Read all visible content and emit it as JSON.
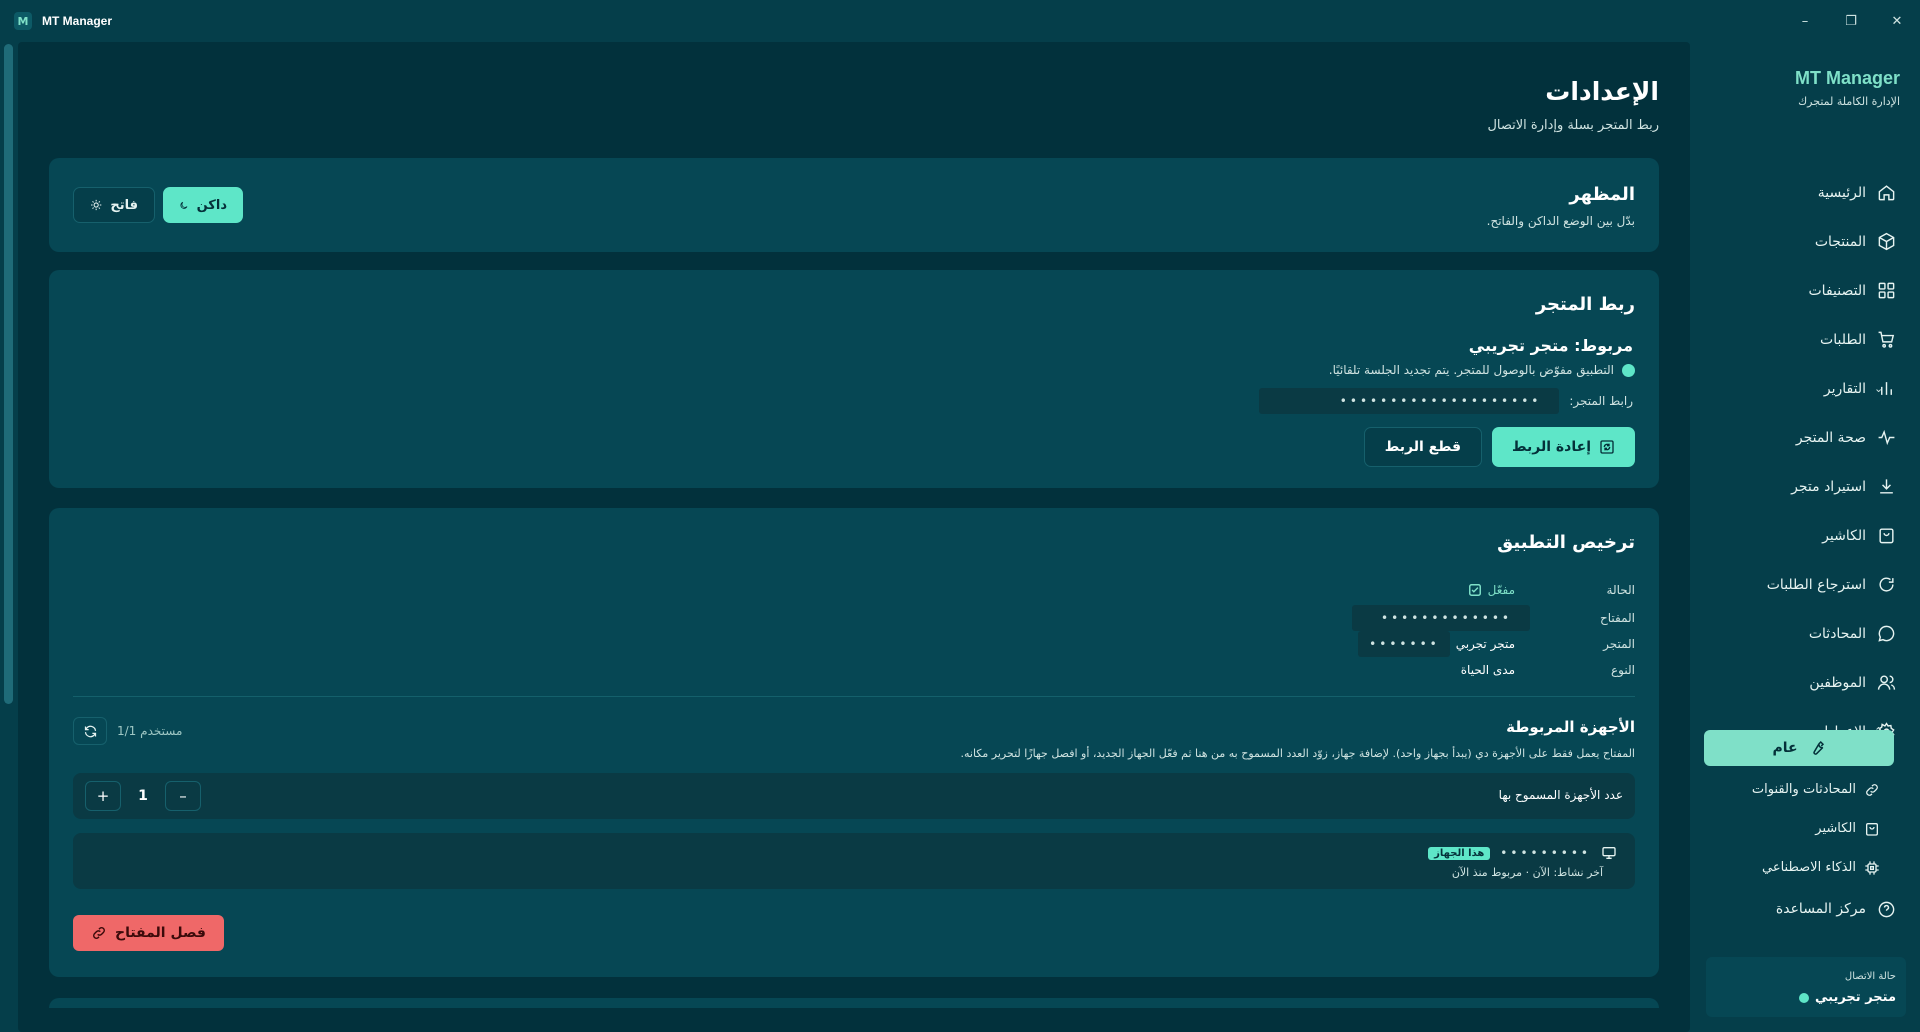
{
  "window": {
    "title": "MT Manager",
    "app_icon_letter": "M",
    "minimize": "–",
    "maximize": "❐",
    "close": "✕"
  },
  "page": {
    "title": "الإعدادات",
    "subtitle": "ربط المتجر بسلة وإدارة الاتصال"
  },
  "appearance": {
    "title": "المظهر",
    "description": "بدّل بين الوضع الداكن والفاتح.",
    "dark_label": "داكن",
    "light_label": "فاتح",
    "active": "dark"
  },
  "store_link": {
    "title": "ربط المتجر",
    "connected_text": "مربوط: متجر تجريبي",
    "status_text": "التطبيق مفوّض بالوصول للمتجر. يتم تجديد الجلسة تلقائيًا.",
    "link_label": "رابط المتجر:",
    "link_value": "••••••••••••••••••••",
    "reconnect_label": "إعادة الربط",
    "disconnect_label": "قطع الربط"
  },
  "license": {
    "title": "ترخيص التطبيق",
    "status_key": "الحالة",
    "status_value": "مفعّل",
    "key_key": "المفتاح",
    "key_value": "•••••••••••••",
    "store_key": "المتجر",
    "store_value": "متجر تجربي",
    "store_masked": "•••••••",
    "type_key": "النوع",
    "type_value": "مدى الحياة",
    "devices_title": "الأجهزة المربوطة",
    "devices_desc": "المفتاح يعمل فقط على الأجهزة دي (يبدأ بجهاز واحد). لإضافة جهاز، زوّد العدد المسموح به من هنا ثم فعّل الجهاز الجديد، أو افصل جهازًا لتحرير مكانه.",
    "user_count": "1/1 مستخدم",
    "allowed_label": "عدد الأجهزة المسموح بها",
    "allowed_value": "1",
    "minus": "–",
    "plus": "+",
    "device_masked": "•••••••••",
    "this_device_badge": "هذا الجهاز",
    "device_meta": "آخر نشاط: الآن · مربوط منذ الآن",
    "unlink_label": "فصل المفتاح"
  },
  "sidebar": {
    "brand": "MT Manager",
    "tagline": "الإدارة الكاملة لمتجرك",
    "items": [
      {
        "label": "الرئيسية",
        "icon": "home-icon"
      },
      {
        "label": "المنتجات",
        "icon": "box-icon"
      },
      {
        "label": "التصنيفات",
        "icon": "grid-icon"
      },
      {
        "label": "الطلبات",
        "icon": "cart-icon"
      },
      {
        "label": "التقارير",
        "icon": "chart-icon"
      },
      {
        "label": "صحة المتجر",
        "icon": "pulse-icon"
      },
      {
        "label": "استيراد متجر",
        "icon": "download-icon"
      },
      {
        "label": "الكاشير",
        "icon": "bag-icon"
      },
      {
        "label": "استرجاع الطلبات",
        "icon": "refresh-icon"
      },
      {
        "label": "المحادثات",
        "icon": "chat-icon"
      },
      {
        "label": "الموظفين",
        "icon": "users-icon"
      },
      {
        "label": "الإعدادات",
        "icon": "gear-icon"
      }
    ],
    "sub_items": {
      "general": "عام",
      "conversations": "المحادثات والقنوات",
      "cashier": "الكاشير",
      "ai": "الذكاء الاصطناعي"
    },
    "help": "مركز المساعدة",
    "connection_label": "حالة الاتصال",
    "connection_value": "متجر تجريبي"
  },
  "colors": {
    "accent": "#5ee6c8",
    "danger": "#ef6868",
    "background": "#02313c",
    "card": "#064754"
  }
}
